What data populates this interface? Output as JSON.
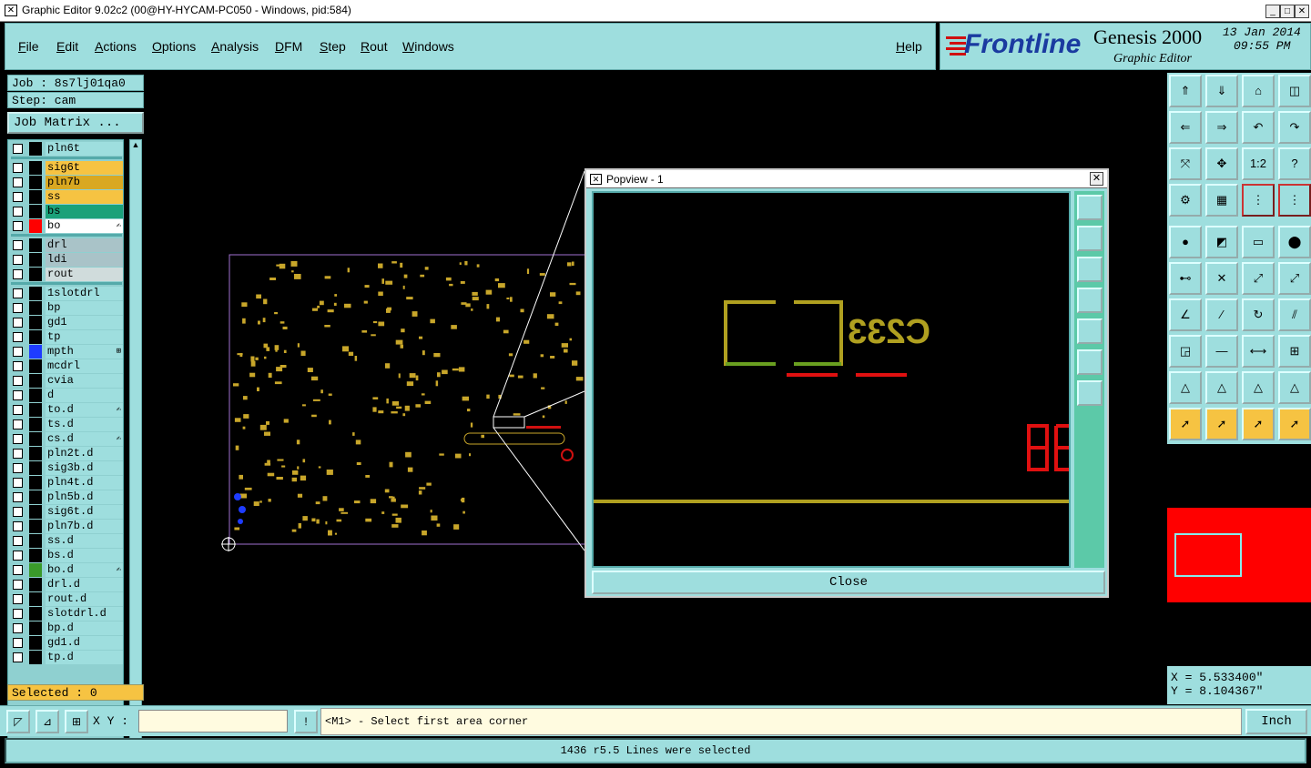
{
  "window": {
    "title": "Graphic Editor 9.02c2 (00@HY-HYCAM-PC050 - Windows, pid:584)"
  },
  "menu": [
    "File",
    "Edit",
    "Actions",
    "Options",
    "Analysis",
    "DFM",
    "Step",
    "Rout",
    "Windows"
  ],
  "help": "Help",
  "brand": {
    "logo": "Frontline",
    "product": "Genesis 2000",
    "subtitle": "Graphic Editor",
    "date": "13 Jan 2014",
    "time": "09:55 PM"
  },
  "job": {
    "job_label": "Job : 8s7lj01qa0",
    "step_label": "Step: cam",
    "matrix_button": "Job Matrix ..."
  },
  "layers": [
    {
      "name": "pln6t",
      "color": "#9edede",
      "swatch": "#000"
    },
    {
      "name": "sig6t",
      "color": "#f6c342",
      "swatch": "#000"
    },
    {
      "name": "pln7b",
      "color": "#d9a821",
      "swatch": "#000"
    },
    {
      "name": "ss",
      "color": "#f6c342",
      "swatch": "#000"
    },
    {
      "name": "bs",
      "color": "#1aa17a",
      "swatch": "#000"
    },
    {
      "name": "bo",
      "color": "#ffffff",
      "swatch": "#ff0000",
      "mark": "✍"
    },
    {
      "name": "drl",
      "color": "#a9c3c8",
      "swatch": "#000"
    },
    {
      "name": "ldi",
      "color": "#a9c3c8",
      "swatch": "#000"
    },
    {
      "name": "rout",
      "color": "#d0dcdc",
      "swatch": "#000"
    },
    {
      "name": "1slotdrl",
      "color": "#9edede",
      "swatch": "#000"
    },
    {
      "name": "bp",
      "color": "#9edede",
      "swatch": "#000"
    },
    {
      "name": "gd1",
      "color": "#9edede",
      "swatch": "#000"
    },
    {
      "name": "tp",
      "color": "#9edede",
      "swatch": "#000"
    },
    {
      "name": "mpth",
      "color": "#9edede",
      "swatch": "#1e3cff",
      "mark": "⊞"
    },
    {
      "name": "mcdrl",
      "color": "#9edede",
      "swatch": "#000"
    },
    {
      "name": "cvia",
      "color": "#9edede",
      "swatch": "#000"
    },
    {
      "name": "d",
      "color": "#9edede",
      "swatch": "#000"
    },
    {
      "name": "to.d",
      "color": "#9edede",
      "swatch": "#000",
      "mark": "✍"
    },
    {
      "name": "ts.d",
      "color": "#9edede",
      "swatch": "#000"
    },
    {
      "name": "cs.d",
      "color": "#9edede",
      "swatch": "#000",
      "mark": "✍"
    },
    {
      "name": "pln2t.d",
      "color": "#9edede",
      "swatch": "#000"
    },
    {
      "name": "sig3b.d",
      "color": "#9edede",
      "swatch": "#000"
    },
    {
      "name": "pln4t.d",
      "color": "#9edede",
      "swatch": "#000"
    },
    {
      "name": "pln5b.d",
      "color": "#9edede",
      "swatch": "#000"
    },
    {
      "name": "sig6t.d",
      "color": "#9edede",
      "swatch": "#000"
    },
    {
      "name": "pln7b.d",
      "color": "#9edede",
      "swatch": "#000"
    },
    {
      "name": "ss.d",
      "color": "#9edede",
      "swatch": "#000"
    },
    {
      "name": "bs.d",
      "color": "#9edede",
      "swatch": "#000"
    },
    {
      "name": "bo.d",
      "color": "#9edede",
      "swatch": "#3a9a2a",
      "mark": "✍"
    },
    {
      "name": "drl.d",
      "color": "#9edede",
      "swatch": "#000"
    },
    {
      "name": "rout.d",
      "color": "#9edede",
      "swatch": "#000"
    },
    {
      "name": "slotdrl.d",
      "color": "#9edede",
      "swatch": "#000"
    },
    {
      "name": "bp.d",
      "color": "#9edede",
      "swatch": "#000"
    },
    {
      "name": "gd1.d",
      "color": "#9edede",
      "swatch": "#000"
    },
    {
      "name": "tp.d",
      "color": "#9edede",
      "swatch": "#000"
    }
  ],
  "selected": "Selected : 0",
  "popview": {
    "title": "Popview - 1",
    "close_label": "Close",
    "label_text": "C233"
  },
  "coords": {
    "x": "X = 5.533400\"",
    "y": "Y = 8.104367\""
  },
  "bottom": {
    "xy_label": "X Y :",
    "xy_value": "",
    "prompt": "<M1> - Select first area corner",
    "unit": "Inch"
  },
  "status": "1436 r5.5 Lines were selected",
  "colors": {
    "panel": "#9edede",
    "highlight": "#f6c342",
    "board": "#c8a62a"
  }
}
